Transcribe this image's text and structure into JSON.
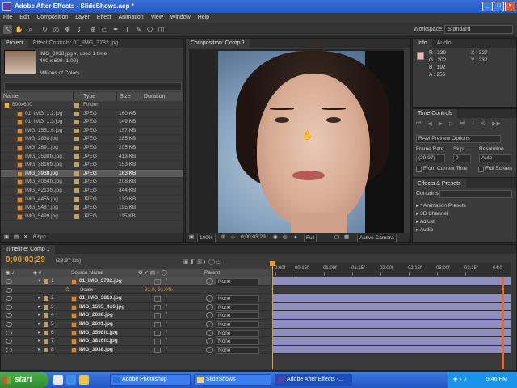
{
  "window": {
    "title": "Adobe After Effects - SlideShows.aep *"
  },
  "menu": [
    "File",
    "Edit",
    "Composition",
    "Layer",
    "Effect",
    "Animation",
    "View",
    "Window",
    "Help"
  ],
  "toolbar": {
    "workspace_label": "Workspace:",
    "workspace_value": "Standard"
  },
  "project_panel": {
    "tabs": [
      "Project",
      "Effect Controls: 01_IMG_3782.jpg"
    ],
    "selected_name": "IMG_3938.jpg ▾, used 1 time",
    "selected_dims": "400 x 600 (1.00)",
    "selected_colors": "Millions of Colors",
    "columns": [
      "Name",
      "Type",
      "Size",
      "Duration"
    ],
    "items": [
      {
        "name": "800x600",
        "type": "Folder",
        "size": ""
      },
      {
        "name": "01_IMG_...2.jpg",
        "type": "JPEG",
        "size": "160 KB"
      },
      {
        "name": "01_IMG_...3.jpg",
        "type": "JPEG",
        "size": "149 KB"
      },
      {
        "name": "IMG_155...6.jpg",
        "type": "JPEG",
        "size": "157 KB"
      },
      {
        "name": "IMG_2638.jpg",
        "type": "JPEG",
        "size": "285 KB"
      },
      {
        "name": "IMG_2691.jpg",
        "type": "JPEG",
        "size": "205 KB"
      },
      {
        "name": "IMG_3598fx.jpg",
        "type": "JPEG",
        "size": "413 KB"
      },
      {
        "name": "IMG_3816fx.jpg",
        "type": "JPEG",
        "size": "153 KB"
      },
      {
        "name": "IMG_3938.jpg",
        "type": "JPEG",
        "size": "163 KB"
      },
      {
        "name": "IMG_4064fx.jpg",
        "type": "JPEG",
        "size": "208 KB"
      },
      {
        "name": "IMG_4213fx.jpg",
        "type": "JPEG",
        "size": "344 KB"
      },
      {
        "name": "IMG_4455.jpg",
        "type": "JPEG",
        "size": "130 KB"
      },
      {
        "name": "IMG_5487.jpg",
        "type": "JPEG",
        "size": "195 KB"
      },
      {
        "name": "IMG_5499.jpg",
        "type": "JPEG",
        "size": "115 KB"
      }
    ],
    "bpc": "8 bpc"
  },
  "comp_panel": {
    "tab": "Composition: Comp 1",
    "zoom": "100%",
    "time": "0;00;03;29",
    "resolution": "Full",
    "camera": "Active Camera"
  },
  "info_panel": {
    "tabs": [
      "Info",
      "Audio"
    ],
    "r": "R : 239",
    "g": "G : 202",
    "b": "B : 192",
    "a": "A : 255",
    "x": "X : 327",
    "y": "Y : 232",
    "swatch": "#eeb8b8"
  },
  "time_controls": {
    "tab": "Time Controls",
    "ram": "RAM Preview Options",
    "frame_rate_label": "Frame Rate",
    "skip_label": "Skip",
    "resolution_label": "Resolution",
    "frame_rate": "(29.97)",
    "skip": "0",
    "resolution": "Auto",
    "from_current": "From Current Time",
    "full_screen": "Full Screen"
  },
  "effects": {
    "tab": "Effects & Presets",
    "contains": "Contains:",
    "items": [
      "* Animation Presets",
      "3D Channel",
      "Adjust",
      "Audio"
    ]
  },
  "timeline": {
    "tab": "Timeline: Comp 1",
    "time": "0;00;03;29",
    "fps": "(29.97 fps)",
    "source_name_header": "Source Name",
    "parent_header": "Parent",
    "scale_label": "Scale",
    "scale_value": "91.0, 91.0%",
    "layers": [
      {
        "n": "1",
        "name": "01_IMG_3782.jpg",
        "parent": "None"
      },
      {
        "n": "2",
        "name": "01_IMG_3813.jpg",
        "parent": "None"
      },
      {
        "n": "3",
        "name": "IMG_1555_4x6.jpg",
        "parent": "None"
      },
      {
        "n": "4",
        "name": "IMG_2638.jpg",
        "parent": "None"
      },
      {
        "n": "5",
        "name": "IMG_2691.jpg",
        "parent": "None"
      },
      {
        "n": "6",
        "name": "IMG_3598fx.jpg",
        "parent": "None"
      },
      {
        "n": "7",
        "name": "IMG_3816fx.jpg",
        "parent": "None"
      },
      {
        "n": "8",
        "name": "IMG_3938.jpg",
        "parent": "None"
      }
    ],
    "ruler": [
      "0:00f",
      "00:15f",
      "01:00f",
      "01:15f",
      "02:00f",
      "02:15f",
      "03:00f",
      "03:15f",
      "04:0"
    ]
  },
  "taskbar": {
    "start": "start",
    "tasks": [
      "Adobe Photoshop",
      "SlideShows",
      "Adobe After Effects -..."
    ],
    "clock": "5:46 PM"
  }
}
